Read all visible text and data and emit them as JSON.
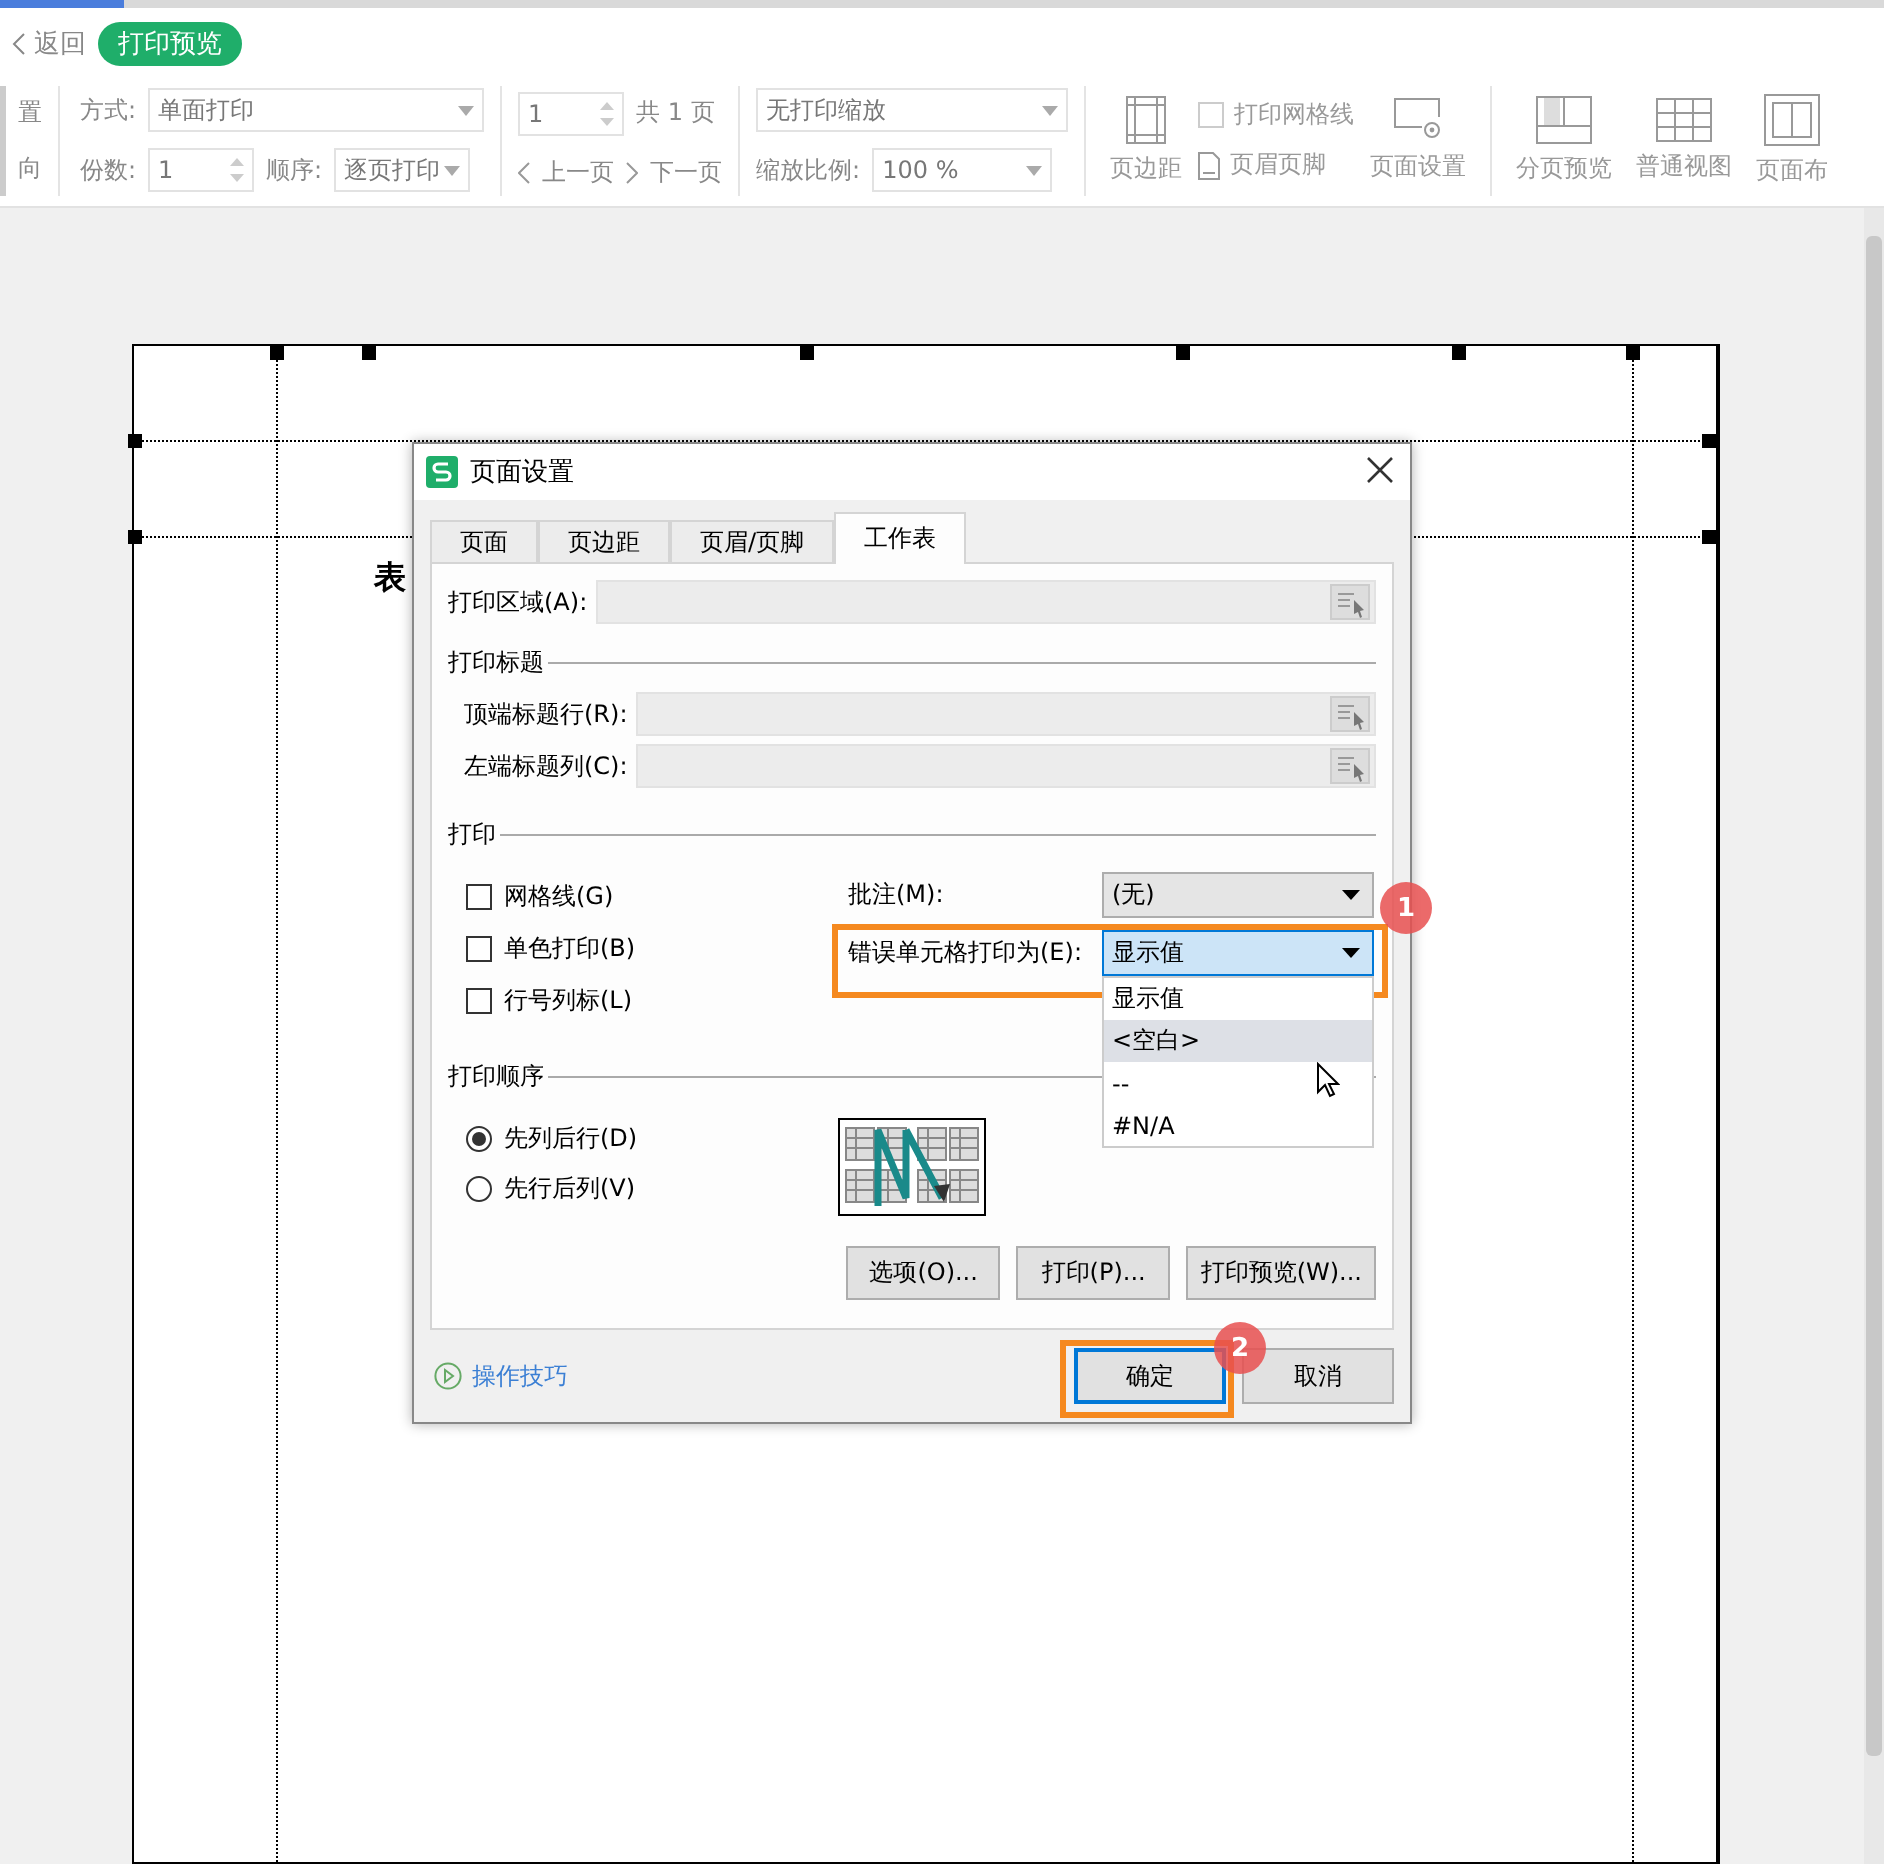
{
  "top_bar": {
    "back": "返回",
    "mode_badge": "打印预览"
  },
  "toolbar": {
    "cut_labels": [
      "置",
      "向"
    ],
    "mode": {
      "label": "方式:",
      "value": "单面打印"
    },
    "copies": {
      "label": "份数:",
      "value": "1"
    },
    "order": {
      "label": "顺序:",
      "value": "逐页打印"
    },
    "page": {
      "value": "1",
      "total": "共 1 页",
      "prev": "上一页",
      "next": "下一页"
    },
    "scaling": {
      "value": "无打印缩放",
      "ratio_label": "缩放比例:",
      "ratio": "100 %"
    },
    "margins": "页边距",
    "gridlines": {
      "label": "打印网格线",
      "checked": false
    },
    "header_footer": "页眉页脚",
    "page_setup": "页面设置",
    "views": [
      "分页预览",
      "普通视图",
      "页面布"
    ]
  },
  "sheet": {
    "title": "表"
  },
  "dialog": {
    "title": "页面设置",
    "tabs": [
      {
        "label": "页面",
        "selected": false
      },
      {
        "label": "页边距",
        "selected": false
      },
      {
        "label": "页眉/页脚",
        "selected": false
      },
      {
        "label": "工作表",
        "selected": true
      }
    ],
    "print_area": "打印区域(A):",
    "titles_section": "打印标题",
    "title_rows": [
      "顶端标题行(R):",
      "左端标题列(C):"
    ],
    "print_section": "打印",
    "checkboxes": [
      {
        "label": "网格线(G)",
        "checked": false
      },
      {
        "label": "单色打印(B)",
        "checked": false
      },
      {
        "label": "行号列标(L)",
        "checked": false
      }
    ],
    "comments": {
      "label": "批注(M):",
      "value": "(无)"
    },
    "errors": {
      "label": "错误单元格打印为(E):",
      "value": "显示值",
      "options": [
        {
          "label": "显示值",
          "highlighted": false
        },
        {
          "label": "<空白>",
          "highlighted": true
        },
        {
          "label": "--",
          "highlighted": false
        },
        {
          "label": "#N/A",
          "highlighted": false
        }
      ]
    },
    "order_section": "打印顺序",
    "order_options": [
      {
        "label": "先列后行(D)",
        "selected": true
      },
      {
        "label": "先行后列(V)",
        "selected": false
      }
    ],
    "buttons": [
      "选项(O)...",
      "打印(P)...",
      "打印预览(W)..."
    ],
    "tips": "操作技巧",
    "footer_buttons": [
      {
        "label": "确定",
        "default": true
      },
      {
        "label": "取消",
        "default": false
      }
    ]
  },
  "annotations": [
    {
      "number": "1"
    },
    {
      "number": "2"
    }
  ]
}
